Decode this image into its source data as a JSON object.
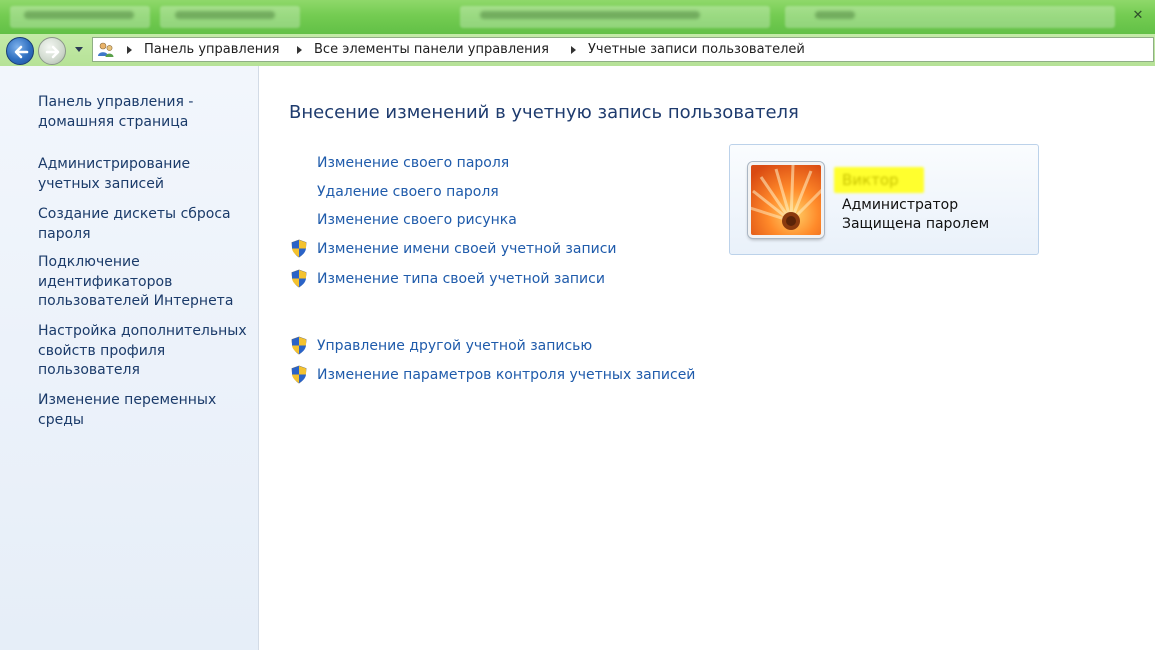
{
  "window": {
    "close_glyph": "✕"
  },
  "address_bar": {
    "icon": "user-accounts-icon",
    "breadcrumbs": [
      {
        "label": "Панель управления"
      },
      {
        "label": "Все элементы панели управления"
      },
      {
        "label": "Учетные записи пользователей"
      }
    ]
  },
  "sidebar": {
    "items": [
      {
        "label": "Панель управления - домашняя страница"
      },
      {
        "label": "Администрирование учетных записей"
      },
      {
        "label": "Создание дискеты сброса пароля"
      },
      {
        "label": "Подключение идентификаторов пользователей Интернета"
      },
      {
        "label": "Настройка дополнительных свойств профиля пользователя"
      },
      {
        "label": "Изменение переменных среды"
      }
    ]
  },
  "main": {
    "title": "Внесение изменений в учетную запись пользователя",
    "tasks": [
      {
        "label": "Изменение своего пароля",
        "icon": null
      },
      {
        "label": "Удаление своего пароля",
        "icon": null
      },
      {
        "label": "Изменение своего рисунка",
        "icon": null
      },
      {
        "label": "Изменение имени своей учетной записи",
        "icon": "uac-shield-icon"
      },
      {
        "label": "Изменение типа своей учетной записи",
        "icon": "uac-shield-icon"
      }
    ],
    "other_tasks": [
      {
        "label": "Управление другой учетной записью",
        "icon": "uac-shield-icon"
      },
      {
        "label": "Изменение параметров контроля учетных записей",
        "icon": "uac-shield-icon"
      }
    ]
  },
  "user_card": {
    "name": "Виктор",
    "role": "Администратор",
    "status": "Защищена паролем",
    "picture": "orange-flower-avatar",
    "name_highlight_color": "#ffff2e"
  },
  "colors": {
    "title_bar": "#74cc52",
    "nav_bar": "#b6e297",
    "link": "#1f5bab",
    "heading": "#1e3b6e",
    "sidebar_bg": "#e6eef8"
  }
}
